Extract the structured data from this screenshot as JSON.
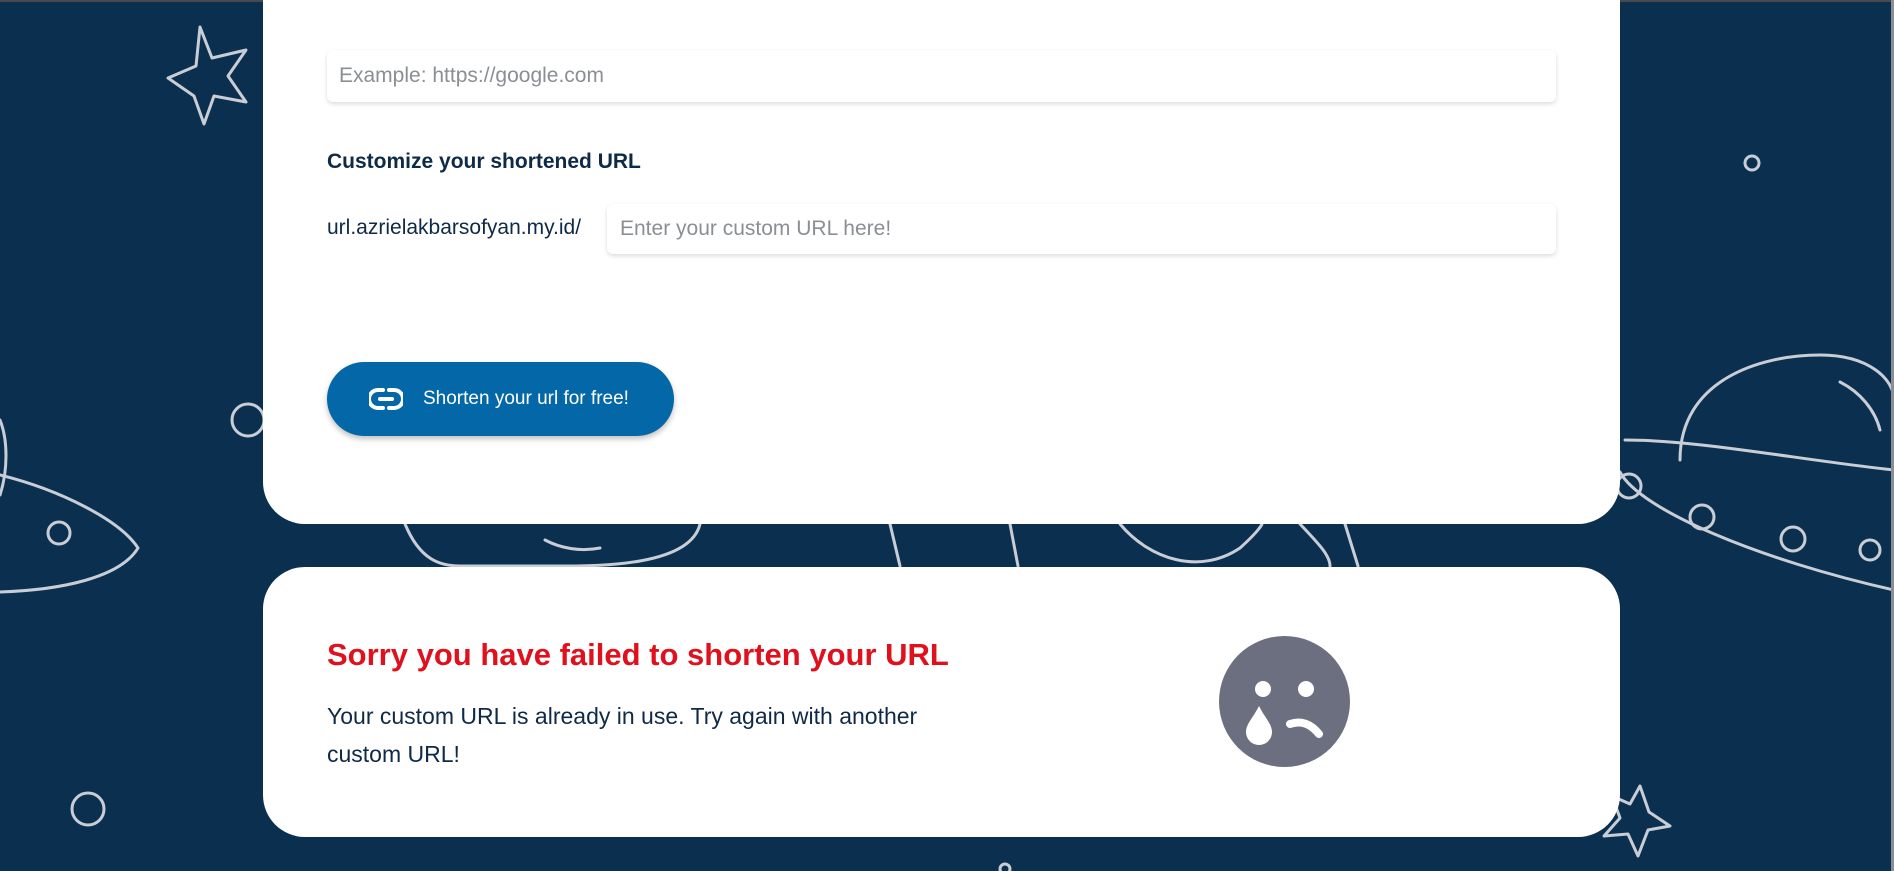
{
  "form": {
    "url_input": {
      "value": "",
      "placeholder": "Example: https://google.com"
    },
    "customize_label": "Customize your shortened URL",
    "custom_url_prefix": "url.azrielakbarsofyan.my.id/",
    "custom_url_input": {
      "value": "",
      "placeholder": "Enter your custom URL here!"
    },
    "shorten_button": {
      "label": "Shorten your url for free!",
      "icon": "link-icon"
    }
  },
  "result": {
    "title": "Sorry you have failed to shorten your URL",
    "message": "Your custom URL is already in use. Try again with another custom URL!",
    "icon": "sad-crying-face-icon"
  },
  "colors": {
    "background": "#0b2f4f",
    "card": "#ffffff",
    "primary_button": "#0467a8",
    "error_title": "#e0101c",
    "text_dark": "#0e2a47",
    "sad_face": "#6b6f7f"
  }
}
